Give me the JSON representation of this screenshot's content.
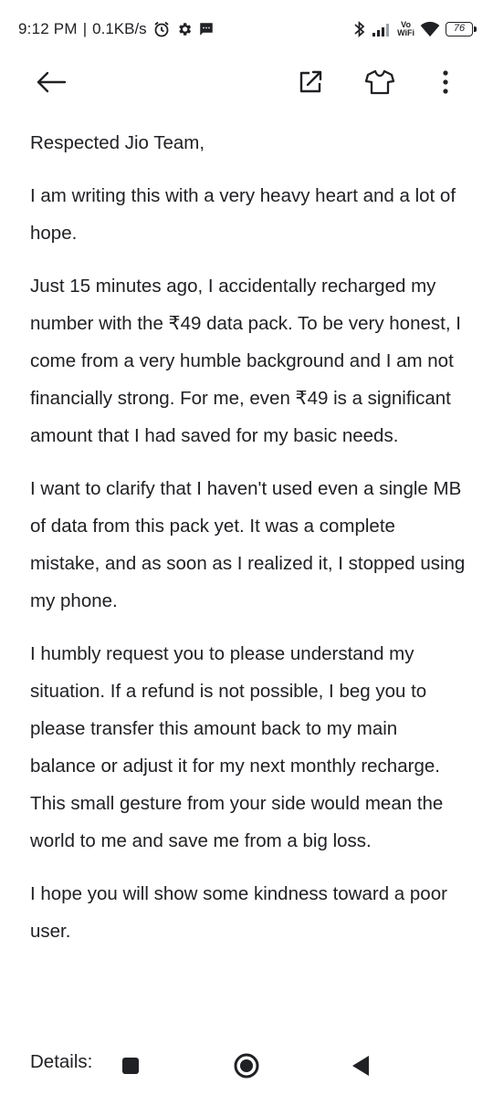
{
  "status_bar": {
    "time": "9:12 PM",
    "separator": "|",
    "speed": "0.1KB/s",
    "volte_top": "Vo",
    "volte_bottom": "WiFi",
    "battery": "76"
  },
  "app_bar": {
    "icons": [
      "arrow-left-icon",
      "open-external-icon",
      "tshirt-icon",
      "more-vert-icon"
    ]
  },
  "content": {
    "paragraphs": [
      "Respected Jio Team,",
      "I am writing this with a very heavy heart and a lot of hope.",
      "Just 15 minutes ago, I accidentally recharged my number with the ₹49 data pack. To be very honest, I come from a very humble background and I am not financially strong. For me, even ₹49 is a significant amount that I had saved for my basic needs.",
      "I want to clarify that I haven't used even a single MB of data from this pack yet. It was a complete mistake, and as soon as I realized it, I stopped using my phone.",
      "I humbly request you to please understand my situation. If a refund is not possible, I beg you to please transfer this amount back to my main balance or adjust it for my next monthly recharge. This small gesture from your side would mean the world to me and save me from a big loss.",
      "I hope you will show some kindness toward a poor user."
    ],
    "details_label": "Details:"
  }
}
